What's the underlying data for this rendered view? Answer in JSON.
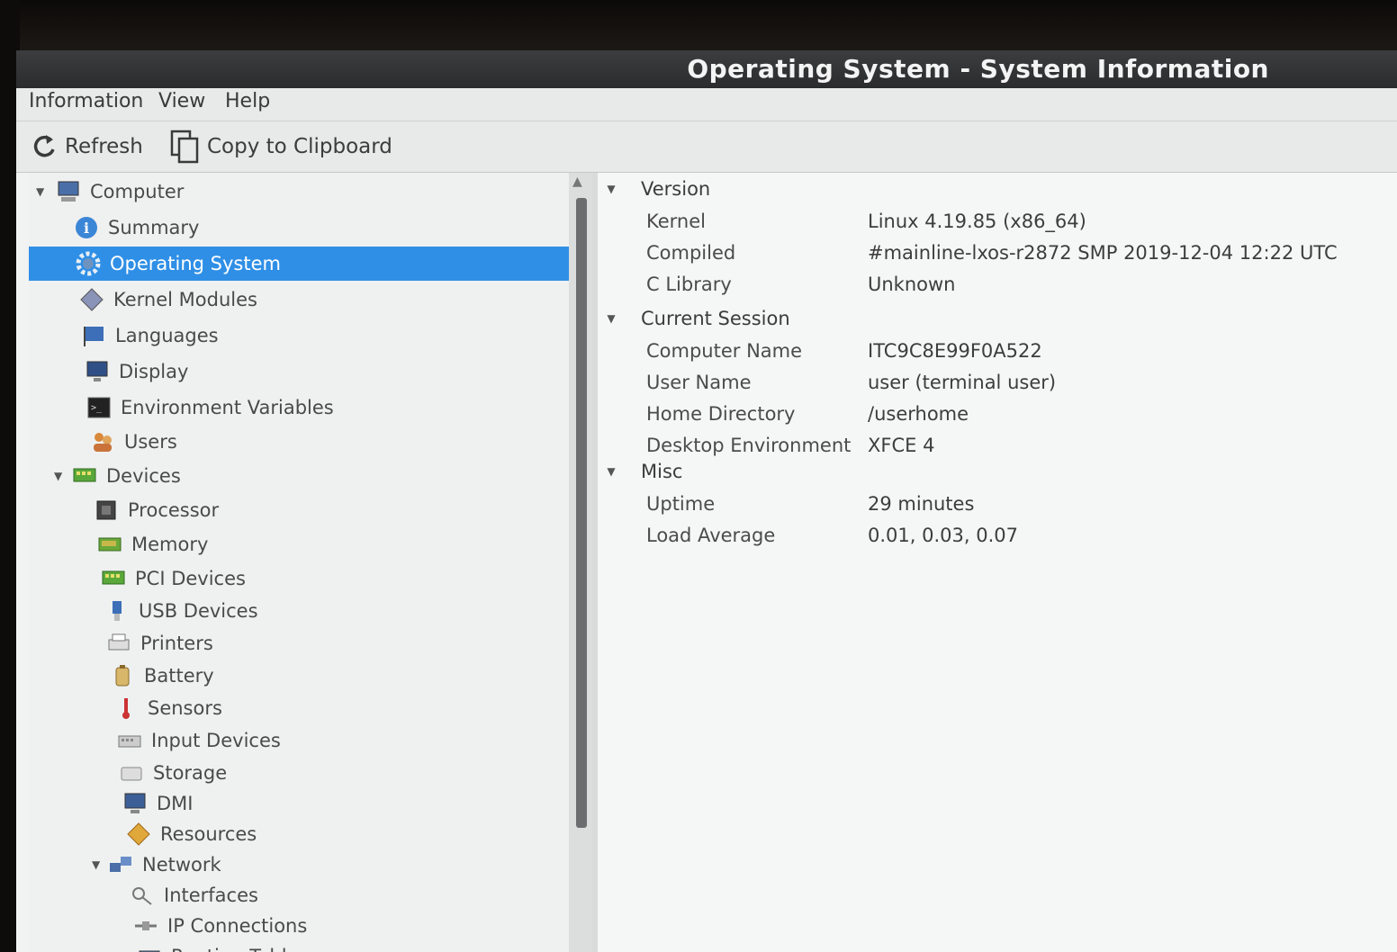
{
  "window": {
    "title": "Operating System - System Information"
  },
  "menu": [
    "Information",
    "View",
    "Help"
  ],
  "toolbar": {
    "refresh_label": "Refresh",
    "copy_label": "Copy to Clipboard"
  },
  "sidebar": {
    "items": [
      {
        "label": "Computer",
        "icon": "computer-icon",
        "expanded": true
      },
      {
        "label": "Summary",
        "icon": "info-icon"
      },
      {
        "label": "Operating System",
        "icon": "gear-icon",
        "selected": true
      },
      {
        "label": "Kernel Modules",
        "icon": "module-icon"
      },
      {
        "label": "Languages",
        "icon": "flag-icon"
      },
      {
        "label": "Display",
        "icon": "display-icon"
      },
      {
        "label": "Environment Variables",
        "icon": "terminal-icon"
      },
      {
        "label": "Users",
        "icon": "users-icon"
      },
      {
        "label": "Devices",
        "icon": "pci-card-icon",
        "expanded": true
      },
      {
        "label": "Processor",
        "icon": "chip-icon"
      },
      {
        "label": "Memory",
        "icon": "memory-icon"
      },
      {
        "label": "PCI Devices",
        "icon": "pci-card-icon"
      },
      {
        "label": "USB Devices",
        "icon": "usb-icon"
      },
      {
        "label": "Printers",
        "icon": "printer-icon"
      },
      {
        "label": "Battery",
        "icon": "battery-icon"
      },
      {
        "label": "Sensors",
        "icon": "thermometer-icon"
      },
      {
        "label": "Input Devices",
        "icon": "keyboard-icon"
      },
      {
        "label": "Storage",
        "icon": "storage-icon"
      },
      {
        "label": "DMI",
        "icon": "monitor-icon"
      },
      {
        "label": "Resources",
        "icon": "diamond-icon"
      },
      {
        "label": "Network",
        "icon": "network-icon",
        "expanded": true
      },
      {
        "label": "Interfaces",
        "icon": "interfaces-icon"
      },
      {
        "label": "IP Connections",
        "icon": "connections-icon"
      },
      {
        "label": "Routing Table",
        "icon": "routing-icon"
      }
    ]
  },
  "details": {
    "sections": [
      {
        "title": "Version",
        "rows": [
          {
            "key": "Kernel",
            "value": "Linux 4.19.85 (x86_64)"
          },
          {
            "key": "Compiled",
            "value": "#mainline-lxos-r2872 SMP 2019-12-04 12:22 UTC"
          },
          {
            "key": "C Library",
            "value": "Unknown"
          }
        ]
      },
      {
        "title": "Current Session",
        "rows": [
          {
            "key": "Computer Name",
            "value": "ITC9C8E99F0A522"
          },
          {
            "key": "User Name",
            "value": "user (terminal user)"
          },
          {
            "key": "Home Directory",
            "value": "/userhome"
          },
          {
            "key": "Desktop Environment",
            "value": "XFCE 4"
          }
        ]
      },
      {
        "title": "Misc",
        "rows": [
          {
            "key": "Uptime",
            "value": "29 minutes"
          },
          {
            "key": "Load Average",
            "value": "0.01, 0.03, 0.07"
          }
        ]
      }
    ]
  },
  "colors": {
    "selection": "#2f8fe6",
    "titlebar": "#2a2c2d"
  }
}
